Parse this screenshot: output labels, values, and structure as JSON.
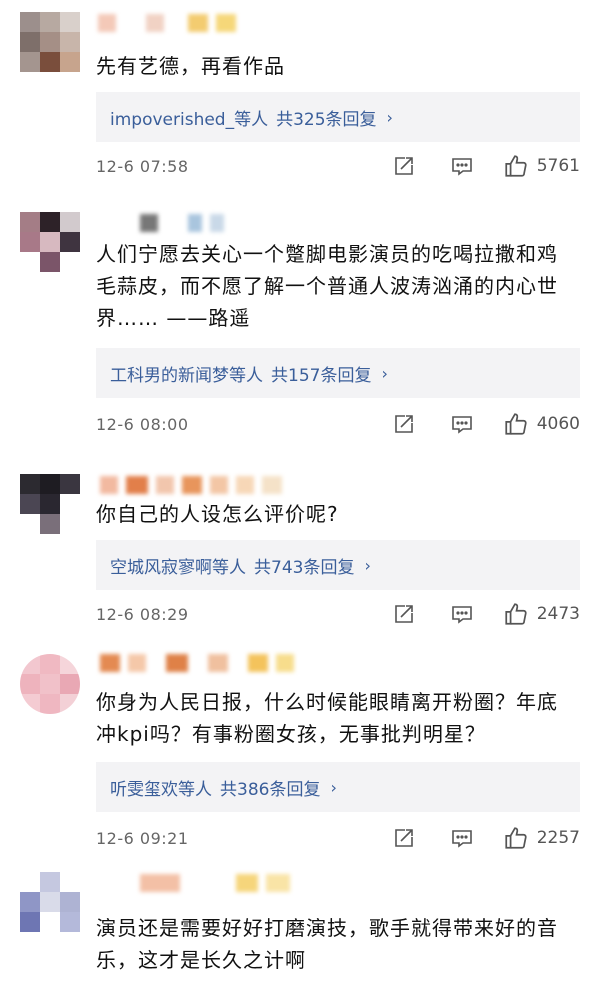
{
  "comments": [
    {
      "text": "先有艺德，再看作品",
      "reply_users": "impoverished_等人",
      "reply_count": "共325条回复",
      "time": "12-6 07:58",
      "likes": "5761"
    },
    {
      "text": "人们宁愿去关心一个蹩脚电影演员的吃喝拉撒和鸡毛蒜皮，而不愿了解一个普通人波涛汹涌的内心世界…… ——路遥",
      "reply_users": "工科男的新闻梦等人",
      "reply_count": "共157条回复",
      "time": "12-6 08:00",
      "likes": "4060"
    },
    {
      "text": "你自己的人设怎么评价呢?",
      "reply_users": "空城风寂寥啊等人",
      "reply_count": "共743条回复",
      "time": "12-6 08:29",
      "likes": "2473"
    },
    {
      "text": "你身为人民日报，什么时候能眼睛离开粉圈？年底冲kpi吗？有事粉圈女孩，无事批判明星？",
      "reply_users": "听雯玺欢等人",
      "reply_count": "共386条回复",
      "time": "12-6 09:21",
      "likes": "2257"
    },
    {
      "text": "演员还是需要好好打磨演技，歌手就得带来好的音乐，这才是长久之计啊"
    }
  ],
  "icons": {
    "share": "share-icon",
    "reply": "comment-icon",
    "like": "thumbs-up-icon",
    "chevron": "chevron-right-icon"
  }
}
